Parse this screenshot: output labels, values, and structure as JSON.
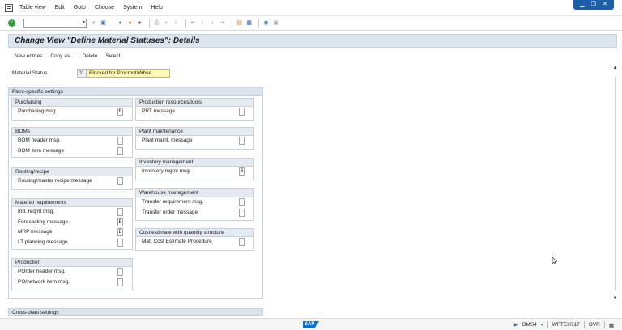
{
  "menu": {
    "items": [
      "Table view",
      "Edit",
      "Goto",
      "Choose",
      "System",
      "Help"
    ]
  },
  "toolbar": {
    "command_value": "",
    "back_chevrons": "«"
  },
  "page": {
    "title": "Change View \"Define Material Statuses\": Details"
  },
  "app_toolbar": {
    "buttons": [
      "New entries",
      "Copy as...",
      "Delete",
      "Select"
    ]
  },
  "material_status": {
    "label": "Material Status",
    "code": "01",
    "value": "Blocked for Procmnt/Whse"
  },
  "plant_specific": {
    "title": "Plant-specific settings",
    "purchasing": {
      "title": "Purchasing",
      "rows": [
        {
          "label": "Purchasing msg.",
          "value": "B"
        }
      ]
    },
    "boms": {
      "title": "BOMs",
      "rows": [
        {
          "label": "BOM header msg.",
          "value": ""
        },
        {
          "label": "BOM item message",
          "value": ""
        }
      ]
    },
    "routing": {
      "title": "Routing/recipe",
      "rows": [
        {
          "label": "Routing/master recipe message",
          "value": ""
        }
      ]
    },
    "material_requirements": {
      "title": "Material requirements",
      "rows": [
        {
          "label": "Ind. reqmt msg.",
          "value": ""
        },
        {
          "label": "Forecasting message",
          "value": "B"
        },
        {
          "label": "MRP message",
          "value": "B"
        },
        {
          "label": "LT planning message",
          "value": ""
        }
      ]
    },
    "production": {
      "title": "Production",
      "rows": [
        {
          "label": "POrder header msg.",
          "value": ""
        },
        {
          "label": "PO/network item msg.",
          "value": ""
        }
      ]
    },
    "prt": {
      "title": "Production resources/tools",
      "rows": [
        {
          "label": "PRT message",
          "value": ""
        }
      ]
    },
    "plant_maintenance": {
      "title": "Plant maintenance",
      "rows": [
        {
          "label": "Plant maint. message",
          "value": ""
        }
      ]
    },
    "inventory": {
      "title": "Inventory management",
      "rows": [
        {
          "label": "Inventory mgmt msg.",
          "value": "B"
        }
      ]
    },
    "warehouse": {
      "title": "Warehouse management",
      "rows": [
        {
          "label": "Transfer requirement msg.",
          "value": ""
        },
        {
          "label": "Transfer order message",
          "value": ""
        }
      ]
    },
    "cost_estimate": {
      "title": "Cost estimate with quantity structure",
      "rows": [
        {
          "label": "Mat. Cost Estimate Procedure",
          "value": ""
        }
      ]
    }
  },
  "cross_plant": {
    "title": "Cross-plant settings"
  },
  "statusbar": {
    "logo": "SAP",
    "system": "OMS4",
    "host": "WFTEH717",
    "mode": "OVR"
  }
}
